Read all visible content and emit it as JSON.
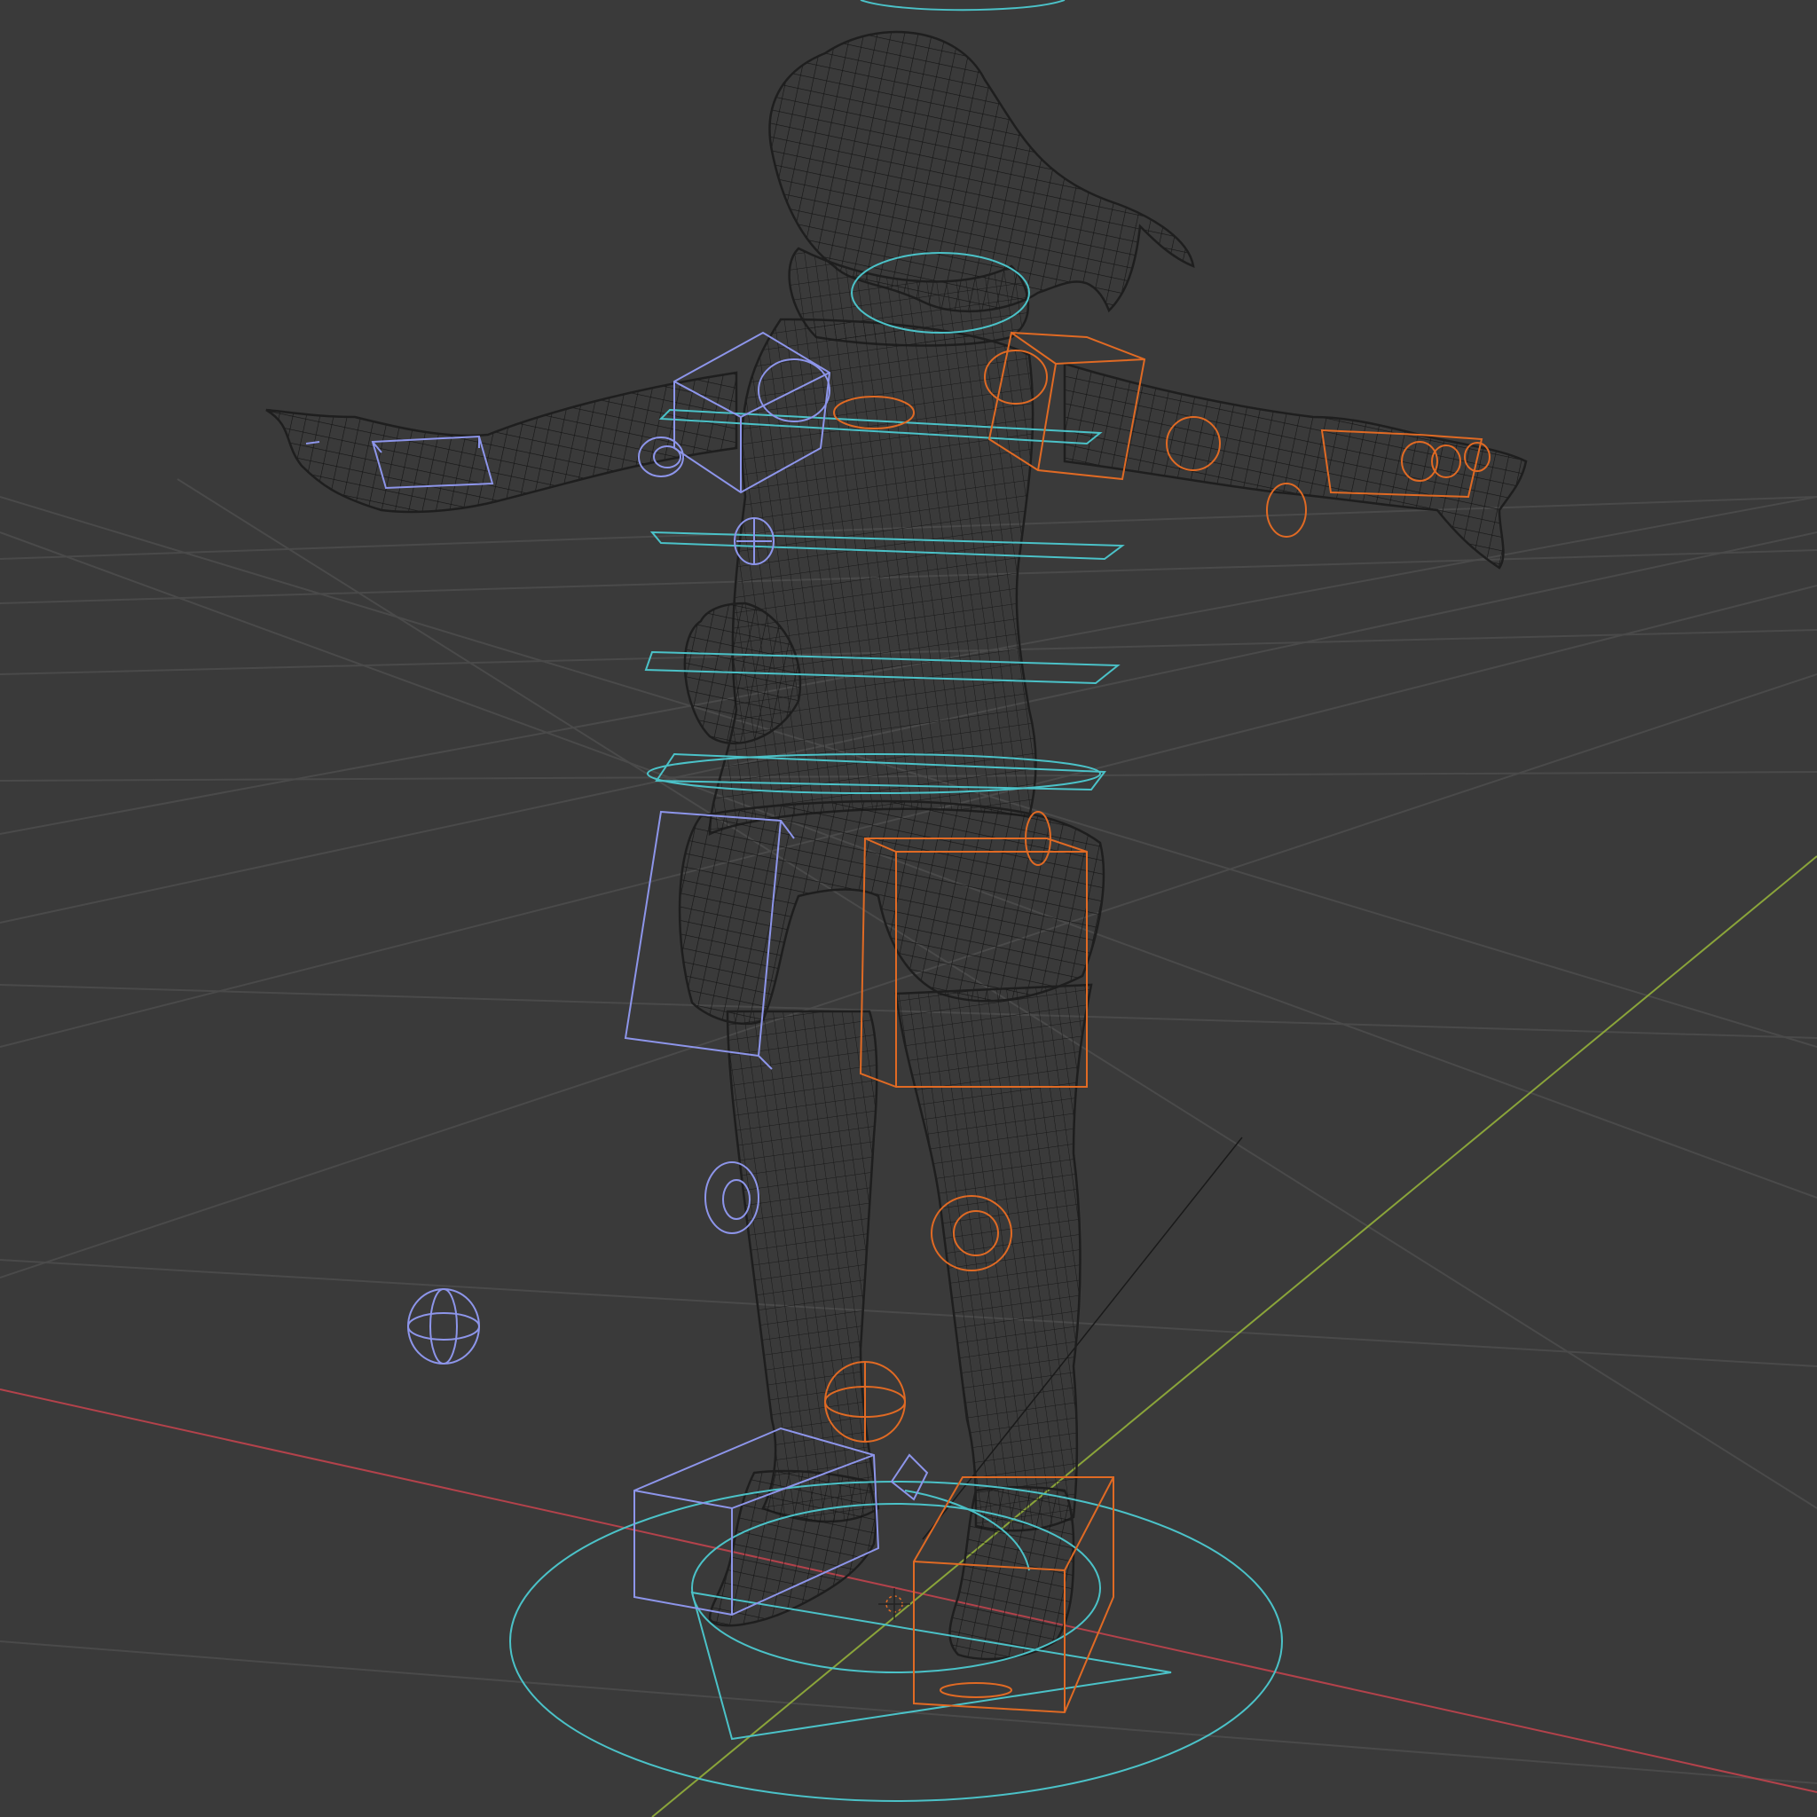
{
  "viewport": {
    "shading": "wireframe",
    "background": "#3a3a3a"
  },
  "colors": {
    "grid": "#4a4a4a",
    "axis_x": "#b3424b",
    "axis_y": "#8aa43a",
    "mesh": "#141414",
    "mesh_outline": "#1e1e1e",
    "control_main": "#4bc2c8",
    "control_left": "#8d95ea",
    "control_right": "#e06a24"
  },
  "objects": {
    "character": "character-wireframe-mesh",
    "rig": "armature-control-rig",
    "cursor": "3d-cursor"
  }
}
